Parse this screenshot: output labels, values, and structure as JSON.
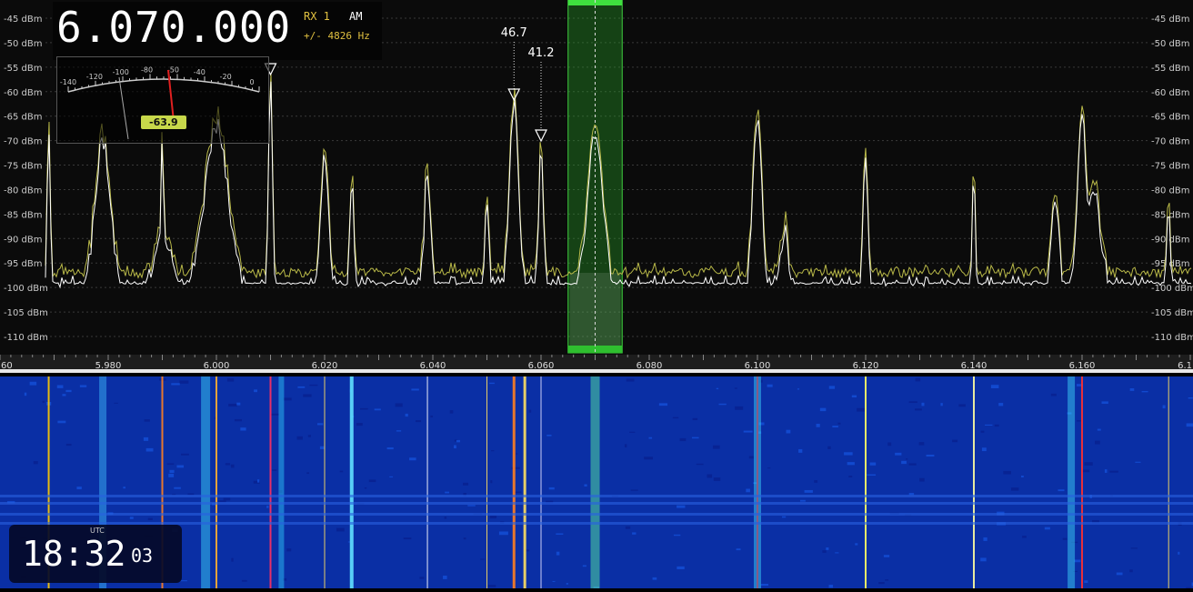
{
  "frequency": {
    "value": "6.070.000",
    "receiver": "RX 1",
    "mode": "AM",
    "offset": "+/- 4826 Hz"
  },
  "smeter": {
    "reading": "-63.9",
    "scale_labels": [
      "-140",
      "-120",
      "-100",
      "-80",
      "-50",
      "-40",
      "-20",
      "0"
    ]
  },
  "dbm_labels": [
    "-45 dBm",
    "-50 dBm",
    "-55 dBm",
    "-60 dBm",
    "-65 dBm",
    "-70 dBm",
    "-75 dBm",
    "-80 dBm",
    "-85 dBm",
    "-90 dBm",
    "-95 dBm",
    "-100 dBm",
    "-105 dBm",
    "-110 dBm"
  ],
  "markers": [
    {
      "label": "46.7",
      "freq": 6.055
    },
    {
      "label": "41.2",
      "freq": 6.06
    },
    {
      "label": "",
      "freq": 6.01
    }
  ],
  "freq_labels": [
    "60",
    "5.980",
    "6.000",
    "6.020",
    "6.040",
    "6.060",
    "6.080",
    "6.100",
    "6.120",
    "6.140",
    "6.160",
    "6.1"
  ],
  "tuned_freq": 6.07,
  "bandwidth_khz": 10,
  "clock": {
    "zone": "UTC",
    "hhmm": "18:32",
    "sec": "03"
  },
  "colors": {
    "trace": "#ffffff",
    "average_trace": "#b8b848",
    "passband": "#2fbf2f",
    "waterfall_bg": "#0a2fa5",
    "marker_red": "#ff3030",
    "meter_value": "#c8d84a"
  }
}
